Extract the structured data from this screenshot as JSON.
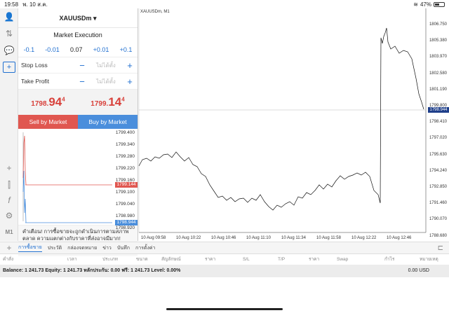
{
  "status": {
    "time": "19:58",
    "date": "พ. 10 ส.ค.",
    "battery": "47%"
  },
  "panel": {
    "symbol": "XAUUSDm ▾",
    "execution": "Market Execution",
    "steps": [
      "-0.1",
      "-0.01",
      "0.07",
      "+0.01",
      "+0.1"
    ],
    "stop_loss_label": "Stop Loss",
    "take_profit_label": "Take Profit",
    "not_set": "ไม่ได้ตั้ง",
    "sell_price": {
      "prefix": "1798.",
      "big": "94",
      "sup": "4"
    },
    "buy_price": {
      "prefix": "1799.",
      "big": "14",
      "sup": "4"
    },
    "sell_label": "Sell by Market",
    "buy_label": "Buy by Market",
    "mini_axis": [
      "1799.400",
      "1799.340",
      "1799.280",
      "1799.220",
      "1799.160",
      "1799.100",
      "1799.040",
      "1798.980",
      "1798.920"
    ],
    "mini_ask_tag": "1799.144",
    "mini_bid_tag": "1798.944",
    "warning": "คำเตือน! การซื้อขายจะถูกดำเนินการตามสภาพตลาด ความแตกต่างกับราคาที่ส่งอาจมีมาก!"
  },
  "chart": {
    "title": "XAUUSDm, M1",
    "y_axis": [
      "1806.750",
      "1805.380",
      "1803.970",
      "1802.580",
      "1801.190",
      "1799.800",
      "1798.410",
      "1797.020",
      "1795.630",
      "1794.240",
      "1792.850",
      "1791.460",
      "1790.070",
      "1788.680"
    ],
    "x_axis": [
      "10 Aug 09:58",
      "10 Aug 10:22",
      "10 Aug 10:46",
      "10 Aug 11:10",
      "10 Aug 11:34",
      "10 Aug 11:58",
      "10 Aug 12:22",
      "10 Aug 12:46"
    ],
    "price_tag": "1798.944"
  },
  "tabs": [
    "การซื้อขาย",
    "ประวัติ",
    "กล่องจดหมาย",
    "ข่าว",
    "บันทึก",
    "การตั้งค่า"
  ],
  "columns": [
    "คำสั่ง",
    "เวลา",
    "ประเภท",
    "ขนาด",
    "สัญลักษณ์",
    "ราคา",
    "S/L",
    "T/P",
    "ราคา",
    "Swap",
    "กำไร",
    "หมายเหตุ"
  ],
  "balance": {
    "text": "Balance: 1 241.73 Equity: 1 241.73 หลักประกัน: 0.00 ฟรี: 1 241.73 Level: 0.00%",
    "amount": "0.00  USD"
  }
}
